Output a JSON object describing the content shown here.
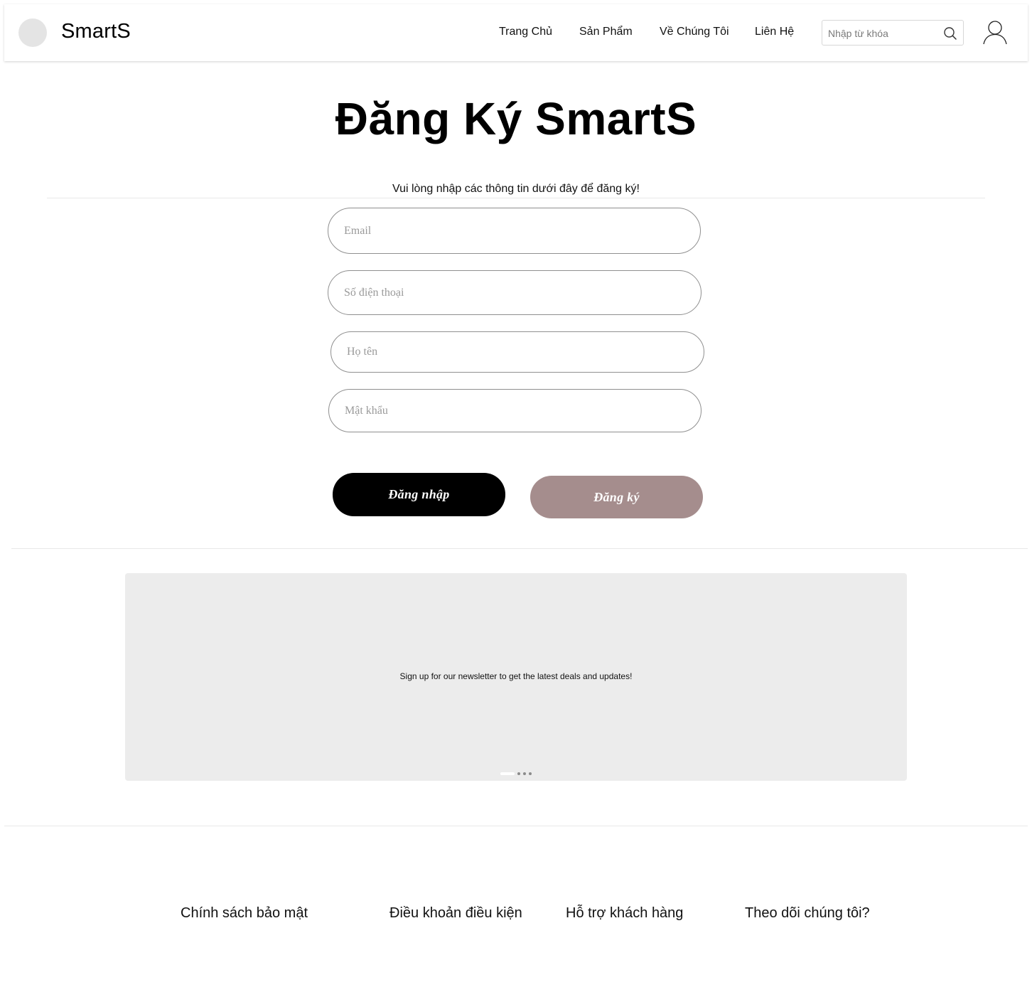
{
  "header": {
    "brand": "SmartS",
    "nav": [
      "Trang Chủ",
      "Sản Phẩm",
      "Về Chúng Tôi",
      "Liên Hệ"
    ],
    "search_placeholder": "Nhập từ khóa"
  },
  "main": {
    "title": "Đăng Ký SmartS",
    "subtitle": "Vui lòng nhập các thông tin dưới đây để đăng ký!",
    "fields": {
      "email_placeholder": "Email",
      "phone_placeholder": "Số điện thoại",
      "name_placeholder": "Họ tên",
      "password_placeholder": "Mật khẩu"
    },
    "login_label": "Đăng nhập",
    "register_label": "Đăng ký"
  },
  "banner": {
    "text": "Sign up for our newsletter to get the latest deals and updates!",
    "slide_count": 4,
    "active_slide": 1
  },
  "footer": {
    "links": [
      "Chính sách bảo mật",
      "Điều khoản điều kiện",
      "Hỗ trợ khách hàng",
      "Theo dõi chúng tôi?"
    ]
  },
  "colors": {
    "register_button": "#a58d8d",
    "login_button": "#000000",
    "banner_bg": "#ececec"
  }
}
